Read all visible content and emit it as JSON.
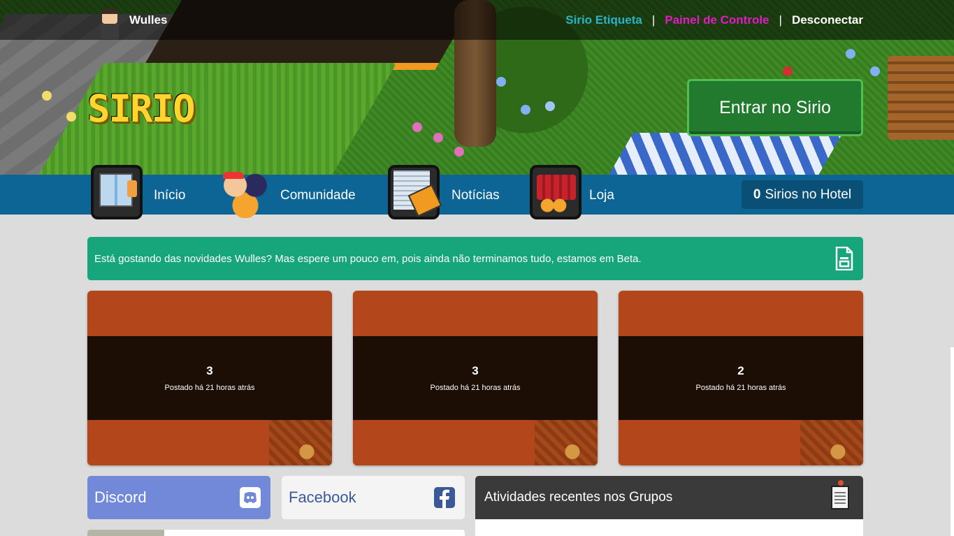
{
  "header": {
    "username": "Wulles",
    "links": {
      "etiqueta": "Sirio Etiqueta",
      "separator": "|",
      "painel": "Painel de Controle",
      "logout": "Desconectar"
    },
    "logo_text": "SIRIO",
    "enter_button": "Entrar no Sirio"
  },
  "nav": {
    "items": [
      {
        "label": "Início",
        "icon": "elevator-icon"
      },
      {
        "label": "Comunidade",
        "icon": "community-icon"
      },
      {
        "label": "Notícias",
        "icon": "newspaper-icon"
      },
      {
        "label": "Loja",
        "icon": "shop-basket-icon"
      }
    ],
    "online_count": "0",
    "online_label": "Sirios no Hotel"
  },
  "alert": {
    "message": "Está gostando das novidades Wulles? Mas espere um pouco em, pois ainda não terminamos tudo, estamos em Beta.",
    "icon": "document-icon"
  },
  "news": [
    {
      "number": "3",
      "meta": "Postado há 21 horas atrás"
    },
    {
      "number": "3",
      "meta": "Postado há 21 horas atrás"
    },
    {
      "number": "2",
      "meta": "Postado há 21 horas atrás"
    }
  ],
  "social": {
    "discord": "Discord",
    "facebook": "Facebook"
  },
  "groups": {
    "title": "Atividades recentes nos Grupos"
  },
  "colors": {
    "accent_green": "#227a2f",
    "nav_blue": "#0c6595",
    "alert_green": "#17a67c",
    "card_orange": "#b4461c",
    "discord": "#7289da",
    "facebook": "#3b5998",
    "etiqueta_link": "#29b3c9",
    "painel_link": "#e619c6"
  }
}
